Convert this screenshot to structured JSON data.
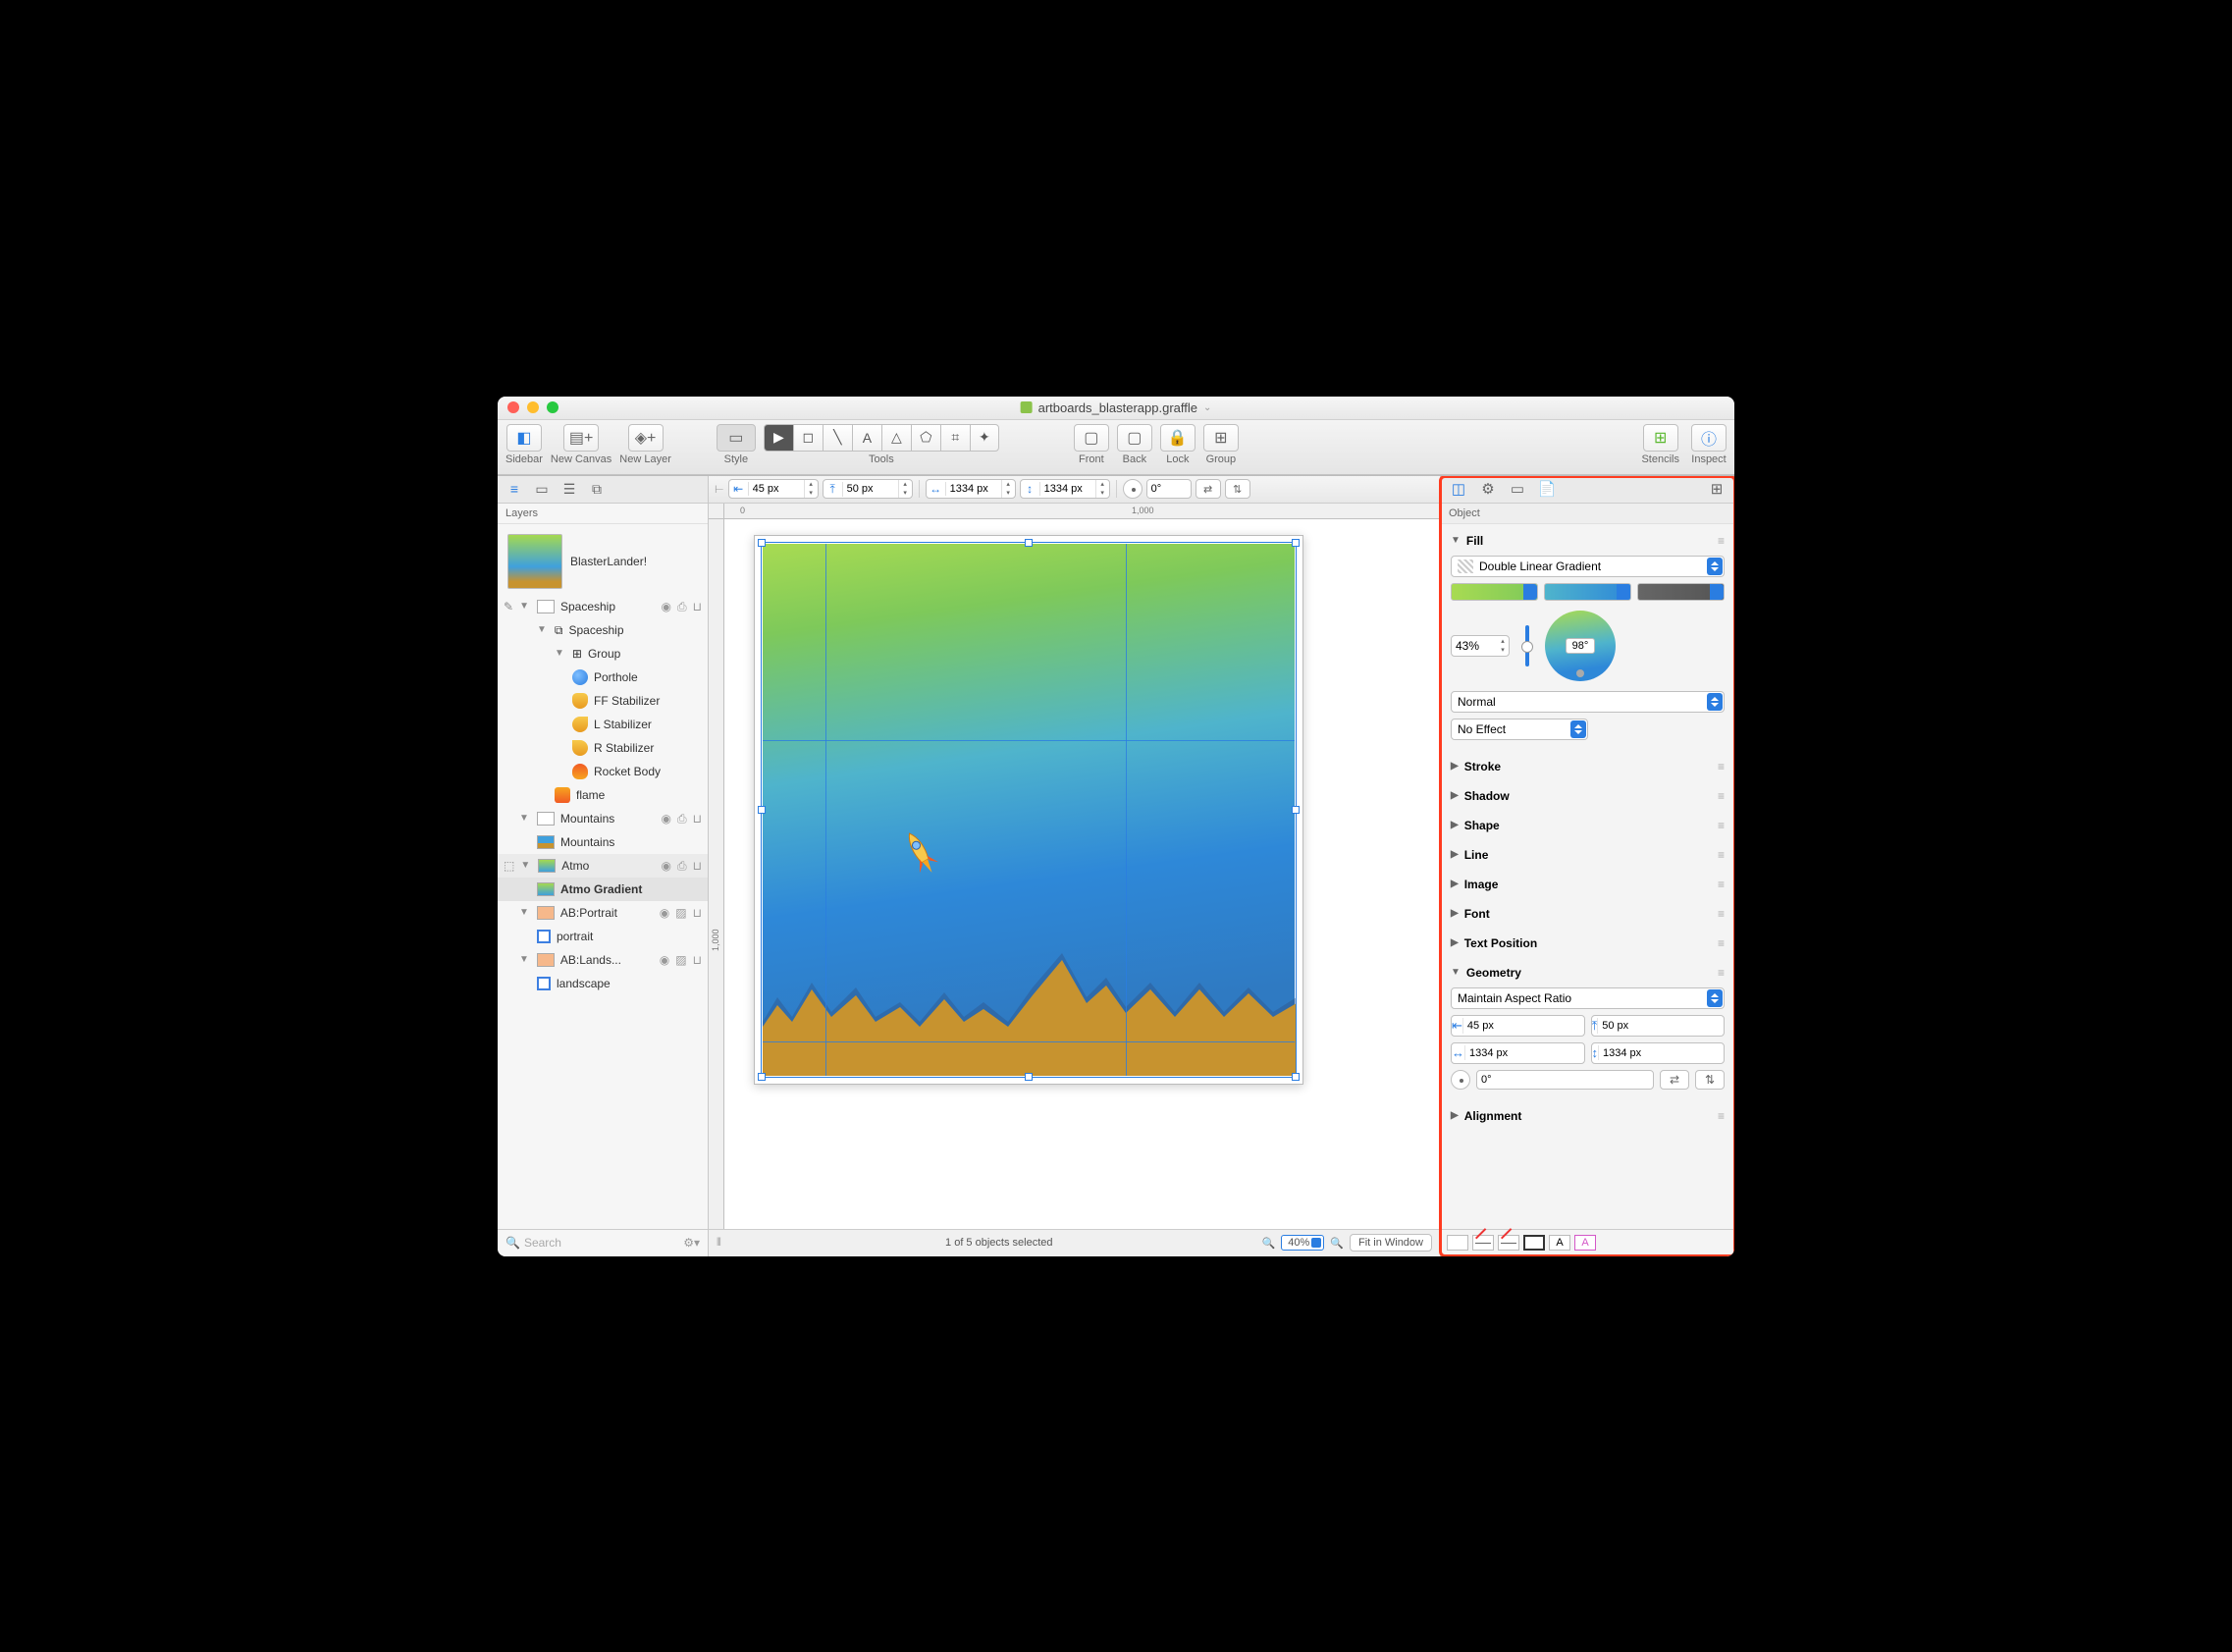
{
  "window": {
    "title": "artboards_blasterapp.graffle"
  },
  "toolbar": {
    "sidebar": "Sidebar",
    "new_canvas": "New Canvas",
    "new_layer": "New Layer",
    "style": "Style",
    "tools": "Tools",
    "front": "Front",
    "back": "Back",
    "lock": "Lock",
    "group": "Group",
    "stencils": "Stencils",
    "inspect": "Inspect"
  },
  "measure": {
    "x": "45 px",
    "y": "50 px",
    "w": "1334 px",
    "h": "1334 px",
    "rot": "0°"
  },
  "sidebar": {
    "header": "Layers",
    "canvas": "BlasterLander!",
    "layers": {
      "spaceship_layer": "Spaceship",
      "spaceship_group": "Spaceship",
      "group": "Group",
      "porthole": "Porthole",
      "ff_stab": "FF Stabilizer",
      "l_stab": "L Stabilizer",
      "r_stab": "R Stabilizer",
      "rocket_body": "Rocket Body",
      "flame": "flame",
      "mountains_layer": "Mountains",
      "mountains_shape": "Mountains",
      "atmo": "Atmo",
      "atmo_grad": "Atmo Gradient",
      "abp": "AB:Portrait",
      "portrait": "portrait",
      "abl": "AB:Lands...",
      "landscape": "landscape"
    },
    "search_placeholder": "Search"
  },
  "ruler": {
    "t0": "0",
    "t1000": "1,000",
    "v1000": "1,000"
  },
  "footer": {
    "selection": "1 of 5 objects selected",
    "zoom": "40%",
    "fit": "Fit in Window"
  },
  "inspector": {
    "header": "Object",
    "sections": {
      "fill": "Fill",
      "stroke": "Stroke",
      "shadow": "Shadow",
      "shape": "Shape",
      "line": "Line",
      "image": "Image",
      "font": "Font",
      "text_pos": "Text Position",
      "geometry": "Geometry",
      "alignment": "Alignment"
    },
    "fill": {
      "type": "Double Linear Gradient",
      "pct": "43%",
      "angle": "98°",
      "blend": "Normal",
      "effect": "No Effect"
    },
    "geometry": {
      "aspect": "Maintain Aspect Ratio",
      "x": "45 px",
      "y": "50 px",
      "w": "1334 px",
      "h": "1334 px",
      "rot": "0°"
    }
  }
}
